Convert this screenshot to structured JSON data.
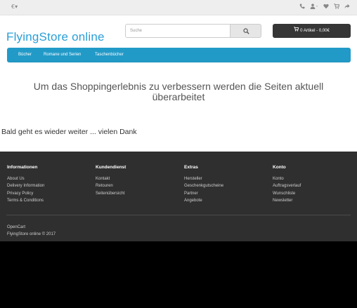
{
  "topbar": {
    "currency": "€▾",
    "icons": [
      "phone-icon",
      "user-icon",
      "heart-icon",
      "cart-icon",
      "share-icon"
    ]
  },
  "header": {
    "logo": "FlyingStore online",
    "search_placeholder": "Suche",
    "cart_label": "0 Artikel - 0,00€"
  },
  "menu": {
    "items": [
      "Bücher",
      "Romane und Serien",
      "Taschenbücher"
    ]
  },
  "maintenance": {
    "title_line1": "Um das Shoppingerlebnis zu verbessern werden die Seiten aktuell",
    "title_line2": "überarbeitet",
    "text": "Bald geht es wieder weiter ... vielen Dank"
  },
  "footer": {
    "columns": [
      {
        "title": "Informationen",
        "links": [
          "About Us",
          "Delivery Information",
          "Privacy Policy",
          "Terms & Conditions"
        ]
      },
      {
        "title": "Kundendienst",
        "links": [
          "Kontakt",
          "Retouren",
          "Seitenübersicht"
        ]
      },
      {
        "title": "Extras",
        "links": [
          "Hersteller",
          "Geschenkgutscheine",
          "Partner",
          "Angebote"
        ]
      },
      {
        "title": "Konto",
        "links": [
          "Konto",
          "Auftragsverlauf",
          "Wunschliste",
          "Newsletter"
        ]
      }
    ],
    "powered_line1": "OpenCart",
    "powered_line2": "FlyingStore online © 2017"
  }
}
